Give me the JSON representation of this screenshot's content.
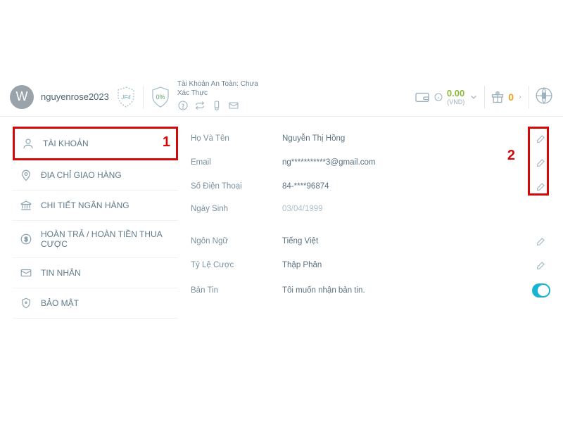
{
  "header": {
    "avatar_letter": "W",
    "username": "nguyenrose2023",
    "badge_text": "JF4",
    "pct": "0%",
    "safety_label": "Tài Khoản An Toàn: Chưa Xác Thực",
    "wallet_amount": "0.00",
    "wallet_currency": "(VND)",
    "gift_count": "0"
  },
  "sidebar": {
    "items": [
      {
        "label": "TÀI KHOẢN"
      },
      {
        "label": "ĐỊA CHỈ GIAO HÀNG"
      },
      {
        "label": "CHI TIẾT NGÂN HÀNG"
      },
      {
        "label": "HOÀN TRẢ / HOÀN TIỀN THUA CƯỢC"
      },
      {
        "label": "TIN NHẮN"
      },
      {
        "label": "BẢO MẬT"
      }
    ]
  },
  "profile": {
    "name_label": "Họ Và Tên",
    "name_value": "Nguyễn Thị Hồng",
    "email_label": "Email",
    "email_value": "ng***********3@gmail.com",
    "phone_label": "Số Điện Thoại",
    "phone_value": "84-****96874",
    "dob_label": "Ngày Sinh",
    "dob_value": "03/04/1999",
    "lang_label": "Ngôn Ngữ",
    "lang_value": "Tiếng Việt",
    "odds_label": "Tỷ Lệ Cược",
    "odds_value": "Thập Phân",
    "news_label": "Bản Tin",
    "news_value": "Tôi muốn nhận bản tin."
  },
  "annotations": {
    "one": "1",
    "two": "2"
  }
}
